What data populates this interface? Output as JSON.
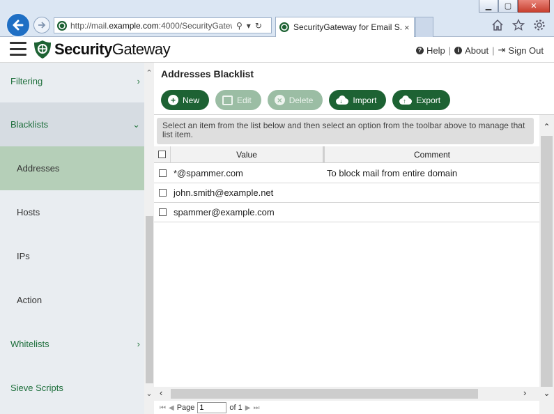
{
  "browser": {
    "url_prefix": "http://mail.",
    "url_domain": "example.com",
    "url_suffix": ":4000/SecurityGatew",
    "tab_title": "SecurityGateway for Email S...",
    "tab_close": "×"
  },
  "header": {
    "brand_bold": "Security",
    "brand_light": "Gateway",
    "help": "Help",
    "about": "About",
    "signout": "Sign Out"
  },
  "sidebar": {
    "items": [
      {
        "label": "Filtering"
      },
      {
        "label": "Blacklists"
      },
      {
        "label": "Addresses"
      },
      {
        "label": "Hosts"
      },
      {
        "label": "IPs"
      },
      {
        "label": "Action"
      },
      {
        "label": "Whitelists"
      },
      {
        "label": "Sieve Scripts"
      }
    ]
  },
  "main": {
    "title": "Addresses Blacklist",
    "toolbar": {
      "new": "New",
      "edit": "Edit",
      "delete": "Delete",
      "import": "Import",
      "export": "Export"
    },
    "hint": "Select an item from the list below and then select an option from the toolbar above to manage that list item.",
    "columns": {
      "value": "Value",
      "comment": "Comment"
    },
    "rows": [
      {
        "value": "*@spammer.com",
        "comment": "To block mail from entire domain"
      },
      {
        "value": "john.smith@example.net",
        "comment": ""
      },
      {
        "value": "spammer@example.com",
        "comment": ""
      }
    ],
    "pager": {
      "page_label": "Page",
      "page_value": "1",
      "of_label": "of 1"
    }
  },
  "colors": {
    "accent": "#1d6233",
    "sidebar_active": "#b5cfb8",
    "sidebar_bg": "#e9edf1",
    "link_green": "#1e6f3c"
  }
}
